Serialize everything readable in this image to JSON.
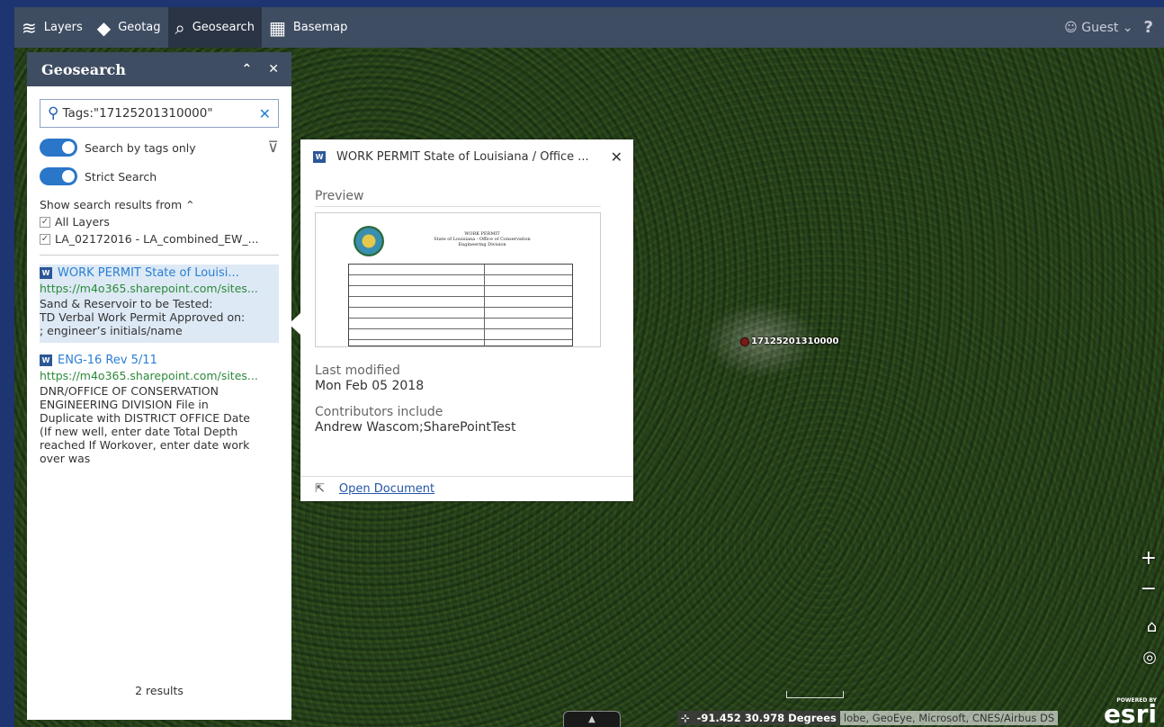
{
  "topbar": {
    "items": [
      {
        "label": "Layers",
        "icon": "layers-icon"
      },
      {
        "label": "Geotag",
        "icon": "tag-icon"
      },
      {
        "label": "Geosearch",
        "icon": "geosearch-icon"
      },
      {
        "label": "Basemap",
        "icon": "basemap-icon"
      }
    ],
    "user": "Guest",
    "help": "?"
  },
  "panel": {
    "title": "Geosearch",
    "search_value": "Tags:\"17125201310000\"",
    "toggle_tags": "Search by tags only",
    "toggle_strict": "Strict Search",
    "source_label": "Show search results from",
    "layers": [
      "All Layers",
      "LA_02172016 - LA_combined_EW_..."
    ],
    "results": [
      {
        "title": "WORK PERMIT State of Louisi...",
        "url": "https://m4o365.sharepoint.com/sites...",
        "desc": "Sand & Reservoir to be Tested:\nTD Verbal Work Permit Approved on:\n        ; engineer’s initials/name"
      },
      {
        "title": "ENG-16 Rev 5/11",
        "url": "https://m4o365.sharepoint.com/sites...",
        "desc": "DNR/OFFICE OF CONSERVATION\nENGINEERING DIVISION File in\nDuplicate with DISTRICT OFFICE Date\n(If new well, enter date Total Depth\nreached If Workover, enter date work\nover was"
      }
    ],
    "count": "2 results"
  },
  "popup": {
    "title": "WORK PERMIT State of Louisiana / Office ...",
    "preview_label": "Preview",
    "doc_heading": "WORK PERMIT\nState of Louisiana - Office of Conservation\nEngineering Division",
    "modified_label": "Last modified",
    "modified_value": "Mon Feb 05 2018",
    "contrib_label": "Contributors include",
    "contrib_value": "Andrew Wascom;SharePointTest",
    "open_label": "Open Document"
  },
  "map": {
    "marker_label": "17125201310000",
    "coords": "-91.452 30.978 Degrees",
    "attribution": "lobe, GeoEye, Microsoft, CNES/Airbus DS",
    "esri_powered": "POWERED BY",
    "esri_logo": "esri",
    "zoom_in": "+",
    "zoom_out": "−"
  }
}
